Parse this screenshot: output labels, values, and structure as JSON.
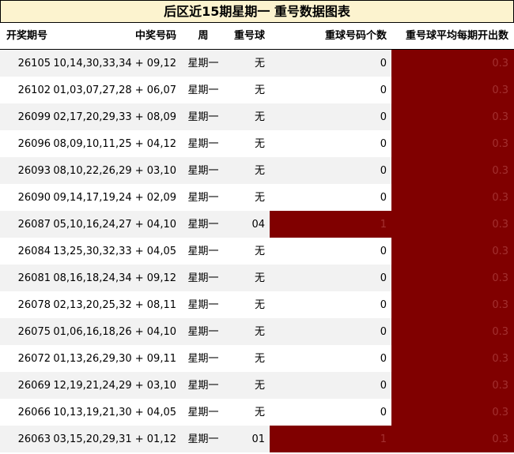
{
  "title": "后区近15期星期一  重号数据图表",
  "columns": {
    "issue": "开奖期号",
    "numbers": "中奖号码",
    "weekday": "周",
    "repeat": "重号球",
    "count": "重球号码个数",
    "avg": "重号球平均每期开出数"
  },
  "colors": {
    "bar": "#800000",
    "title_bg": "#fcf3cf",
    "shade": "#f2f2f2"
  },
  "chart_data": {
    "type": "table",
    "count_max": 1,
    "avg_max": 0.3,
    "rows": [
      {
        "issue": "26105",
        "numbers": "10,14,30,33,34 + 09,12",
        "weekday": "星期一",
        "repeat": "无",
        "count": 0,
        "avg": 0.3
      },
      {
        "issue": "26102",
        "numbers": "01,03,07,27,28 + 06,07",
        "weekday": "星期一",
        "repeat": "无",
        "count": 0,
        "avg": 0.3
      },
      {
        "issue": "26099",
        "numbers": "02,17,20,29,33 + 08,09",
        "weekday": "星期一",
        "repeat": "无",
        "count": 0,
        "avg": 0.3
      },
      {
        "issue": "26096",
        "numbers": "08,09,10,11,25 + 04,12",
        "weekday": "星期一",
        "repeat": "无",
        "count": 0,
        "avg": 0.3
      },
      {
        "issue": "26093",
        "numbers": "08,10,22,26,29 + 03,10",
        "weekday": "星期一",
        "repeat": "无",
        "count": 0,
        "avg": 0.3
      },
      {
        "issue": "26090",
        "numbers": "09,14,17,19,24 + 02,09",
        "weekday": "星期一",
        "repeat": "无",
        "count": 0,
        "avg": 0.3
      },
      {
        "issue": "26087",
        "numbers": "05,10,16,24,27 + 04,10",
        "weekday": "星期一",
        "repeat": "04",
        "count": 1,
        "avg": 0.3
      },
      {
        "issue": "26084",
        "numbers": "13,25,30,32,33 + 04,05",
        "weekday": "星期一",
        "repeat": "无",
        "count": 0,
        "avg": 0.3
      },
      {
        "issue": "26081",
        "numbers": "08,16,18,24,34 + 09,12",
        "weekday": "星期一",
        "repeat": "无",
        "count": 0,
        "avg": 0.3
      },
      {
        "issue": "26078",
        "numbers": "02,13,20,25,32 + 08,11",
        "weekday": "星期一",
        "repeat": "无",
        "count": 0,
        "avg": 0.3
      },
      {
        "issue": "26075",
        "numbers": "01,06,16,18,26 + 04,10",
        "weekday": "星期一",
        "repeat": "无",
        "count": 0,
        "avg": 0.3
      },
      {
        "issue": "26072",
        "numbers": "01,13,26,29,30 + 09,11",
        "weekday": "星期一",
        "repeat": "无",
        "count": 0,
        "avg": 0.3
      },
      {
        "issue": "26069",
        "numbers": "12,19,21,24,29 + 03,10",
        "weekday": "星期一",
        "repeat": "无",
        "count": 0,
        "avg": 0.3
      },
      {
        "issue": "26066",
        "numbers": "10,13,19,21,30 + 04,05",
        "weekday": "星期一",
        "repeat": "无",
        "count": 0,
        "avg": 0.3
      },
      {
        "issue": "26063",
        "numbers": "03,15,20,29,31 + 01,12",
        "weekday": "星期一",
        "repeat": "01",
        "count": 1,
        "avg": 0.3
      }
    ]
  }
}
